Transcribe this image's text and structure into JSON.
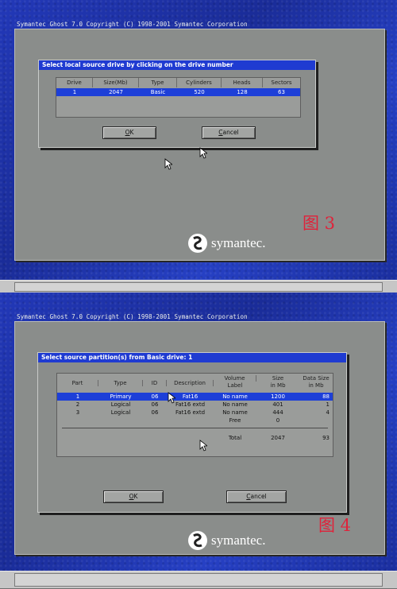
{
  "screen1": {
    "title_bar": "Symantec Ghost 7.0   Copyright (C) 1998-2001 Symantec Corporation",
    "dialog": {
      "title": "Select local source drive by clicking on the drive number",
      "columns": [
        "Drive",
        "Size(Mb)",
        "Type",
        "Cylinders",
        "Heads",
        "Sectors"
      ],
      "rows": [
        {
          "drive": "1",
          "size": "2047",
          "type": "Basic",
          "cylinders": "520",
          "heads": "128",
          "sectors": "63",
          "selected": true
        }
      ],
      "ok_label_u": "O",
      "ok_label_rest": "K",
      "cancel_label_u": "C",
      "cancel_label_rest": "ancel"
    },
    "figure_label": "图 3",
    "logo_text": "symantec."
  },
  "screen2": {
    "title_bar": "Symantec Ghost 7.0   Copyright (C) 1998-2001 Symantec Corporation",
    "dialog": {
      "title": "Select source partition(s) from Basic drive: 1",
      "columns": [
        {
          "l1": "Part",
          "l2": ""
        },
        {
          "l1": "Type",
          "l2": ""
        },
        {
          "l1": "ID",
          "l2": ""
        },
        {
          "l1": "Description",
          "l2": ""
        },
        {
          "l1": "Volume",
          "l2": "Label"
        },
        {
          "l1": "Size",
          "l2": "in Mb"
        },
        {
          "l1": "Data Size",
          "l2": "in Mb"
        }
      ],
      "rows": [
        {
          "part": "1",
          "type": "Primary",
          "id": "06",
          "desc": "Fat16",
          "label": "No name",
          "size": "1200",
          "data": "88",
          "selected": true
        },
        {
          "part": "2",
          "type": "Logical",
          "id": "06",
          "desc": "Fat16 extd",
          "label": "No name",
          "size": "401",
          "data": "1",
          "selected": false
        },
        {
          "part": "3",
          "type": "Logical",
          "id": "06",
          "desc": "Fat16 extd",
          "label": "No name",
          "size": "444",
          "data": "4",
          "selected": false
        },
        {
          "part": "",
          "type": "",
          "id": "",
          "desc": "",
          "label": "Free",
          "size": "0",
          "data": "",
          "selected": false
        }
      ],
      "total_label": "Total",
      "total_size": "2047",
      "total_data": "93",
      "ok_label_u": "O",
      "ok_label_rest": "K",
      "cancel_label_u": "C",
      "cancel_label_rest": "ancel"
    },
    "figure_label": "图 4",
    "logo_text": "symantec."
  },
  "colors": {
    "accent": "#1f3bd1",
    "selection": "#1d3fd8",
    "figure_label": "#e0223a"
  },
  "icons": {
    "pointer": "mouse-cursor-icon",
    "logo": "symantec-logo-icon"
  }
}
